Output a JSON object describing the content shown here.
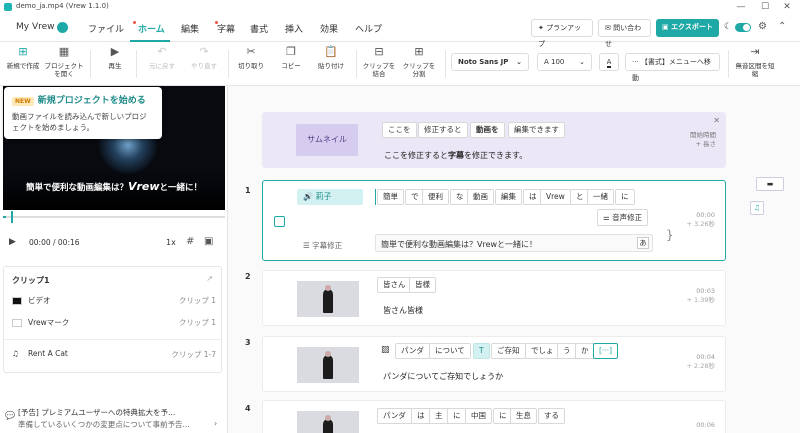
{
  "window": {
    "title": "demo_ja.mp4 (Vrew 1.1.0)",
    "minimize": "—",
    "maximize": "☐",
    "close": "✕"
  },
  "menu": {
    "brand": "My Vrew",
    "items": [
      {
        "label": "ファイル",
        "active": false
      },
      {
        "label": "ホーム",
        "active": true
      },
      {
        "label": "編集",
        "active": false
      },
      {
        "label": "字幕",
        "active": false
      },
      {
        "label": "書式",
        "active": false
      },
      {
        "label": "挿入",
        "active": false
      },
      {
        "label": "効果",
        "active": false
      },
      {
        "label": "ヘルプ",
        "active": false
      }
    ],
    "plan_up": "プランアップ",
    "contact": "問い合わせ",
    "export": "エクスポート",
    "colors": {
      "accent": "#1fa9a6",
      "notify": "#e54444"
    }
  },
  "toolbar": {
    "new_project": "新規で作成",
    "open_project": "プロジェクトを開く",
    "play": "再生",
    "undo": "元に戻す",
    "redo": "やり直す",
    "cut": "切り取り",
    "copy": "コピー",
    "paste": "貼り付け",
    "merge_clips": "クリップを結合",
    "split_clip": "クリップを分割",
    "font": "Noto Sans JP",
    "font_size": "100",
    "format_menu": "【書式】メニューへ移動",
    "silence": "無音区間を短縮"
  },
  "left": {
    "tooltip": {
      "badge": "NEW",
      "title": "新規プロジェクトを始める",
      "desc": "動画ファイルを読み込んで新しいプロジェクトを始めましょう。"
    },
    "video_caption_pre": "簡単で便利な動画編集は？",
    "video_caption_brand": "Vrew",
    "video_caption_post": "と一緒に！",
    "time": "00:00 / 00:16",
    "speed": "1x",
    "clip_panel_title": "クリップ1",
    "clip_rows": [
      {
        "name": "ビデオ",
        "range": "クリップ 1"
      },
      {
        "name": "Vrewマーク",
        "range": "クリップ 1"
      },
      {
        "name": "Rent A Cat",
        "range": "クリップ 1-7"
      }
    ],
    "notice_title": "[予告] プレミアムユーザーへの特典拡大を予...",
    "notice_body": "準備しているいくつかの変更点について事前予告..."
  },
  "main": {
    "thumbnail": {
      "chip": "サムネイル",
      "tags": [
        "ここを",
        "修正すると",
        "動画を",
        "編集できます"
      ],
      "subtitle_pre": "ここを修正すると",
      "subtitle_bold": "字幕",
      "subtitle_post": "を修正できます。",
      "start_time": "開始時間",
      "length": "+ 長さ"
    },
    "clips": [
      {
        "num": "1",
        "speaker": "莉子",
        "tags": [
          "簡単",
          "で",
          "便利",
          "な",
          "動画",
          "編集",
          "は",
          "Vrew",
          "と",
          "一緒",
          "に"
        ],
        "voice_edit": "音声修正",
        "subtitle_label": "字幕修正",
        "subtitle": "簡単で便利な動画編集は？Vrewと一緒に！",
        "start": "00:00",
        "dur": "+ 3.26秒"
      },
      {
        "num": "2",
        "tags": [
          "皆さん",
          "皆様"
        ],
        "subtitle": "皆さん皆様",
        "start": "00:03",
        "dur": "+ 1.39秒"
      },
      {
        "num": "3",
        "tags": [
          "パンダ",
          "について",
          "T",
          "ご存知",
          "でしょ",
          "う",
          "か",
          "[···]"
        ],
        "subtitle": "パンダについてご存知でしょうか",
        "start": "00:04",
        "dur": "+ 2.28秒"
      },
      {
        "num": "4",
        "tags": [
          "パンダ",
          "は",
          "主",
          "に",
          "中国",
          "に",
          "生息",
          "する"
        ],
        "start": "00:06"
      }
    ]
  }
}
